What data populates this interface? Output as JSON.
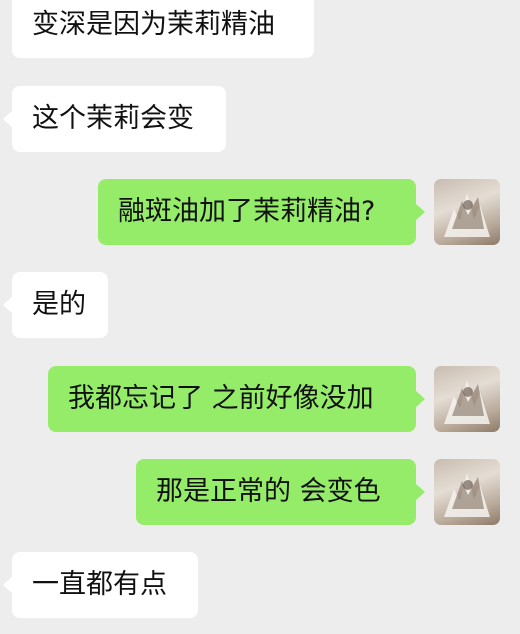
{
  "messages": [
    {
      "side": "incoming",
      "text": "变深是因为茉莉精油"
    },
    {
      "side": "incoming",
      "text": "这个茉莉会变"
    },
    {
      "side": "outgoing",
      "text": "融斑油加了茉莉精油?"
    },
    {
      "side": "incoming",
      "text": "是的"
    },
    {
      "side": "outgoing",
      "text": "我都忘记了 之前好像没加"
    },
    {
      "side": "outgoing",
      "text": "那是正常的 会变色"
    },
    {
      "side": "incoming",
      "text": "一直都有点"
    }
  ],
  "colors": {
    "background": "#ededed",
    "incoming_bubble": "#ffffff",
    "outgoing_bubble": "#95ec69",
    "text": "#111111"
  }
}
